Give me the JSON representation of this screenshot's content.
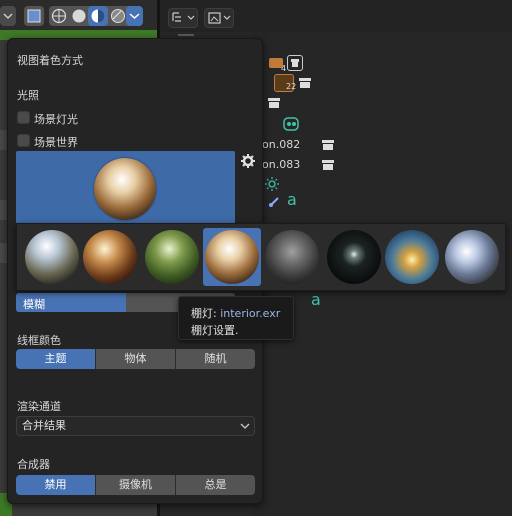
{
  "popover": {
    "title": "视图着色方式",
    "lighting": {
      "section": "光照",
      "scene_lights": "场景灯光",
      "scene_world": "场景世界"
    },
    "blur_label": "模糊",
    "wireframe_color": {
      "section": "线框颜色",
      "options": [
        "主题",
        "物体",
        "随机"
      ],
      "selected": "主题"
    },
    "render_pass": {
      "section": "渲染通道",
      "value": "合并结果"
    },
    "compositor": {
      "section": "合成器",
      "options": [
        "禁用",
        "摄像机",
        "总是"
      ],
      "selected": "禁用"
    }
  },
  "hdri": {
    "items": [
      "city",
      "courtyard",
      "forest",
      "interior",
      "night",
      "studio",
      "sunrise",
      "sunset"
    ],
    "selected": "interior"
  },
  "tooltip": {
    "title": "棚灯:",
    "file": "interior.exr",
    "description": "棚灯设置."
  },
  "outliner": {
    "items": [
      "on.082",
      "on.083"
    ],
    "counts": [
      "4",
      "22"
    ]
  },
  "colors": {
    "accent": "#4772b3",
    "green": "#3e7a25",
    "cyan": "#3fc4a8"
  }
}
